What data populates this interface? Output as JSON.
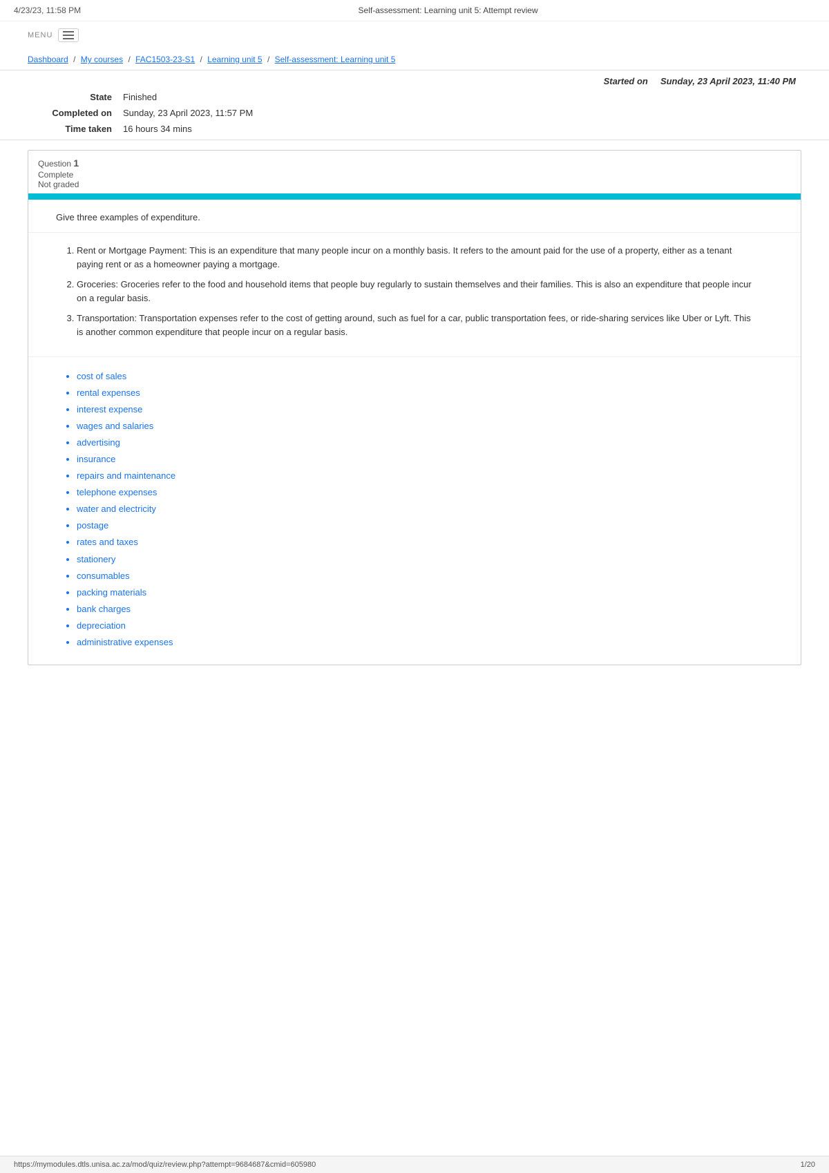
{
  "topbar": {
    "left": "4/23/23, 11:58 PM",
    "center": "Self-assessment: Learning unit 5: Attempt review"
  },
  "menu": {
    "label": "MENU"
  },
  "breadcrumb": {
    "items": [
      {
        "label": "Dashboard",
        "href": "#"
      },
      {
        "label": "My courses",
        "href": "#"
      },
      {
        "label": "FAC1503-23-S1",
        "href": "#"
      },
      {
        "label": "Learning unit 5",
        "href": "#"
      },
      {
        "label": "Self-assessment: Learning unit 5",
        "href": "#"
      }
    ],
    "separator": "/"
  },
  "attempt_info": {
    "started_on_label": "Started on",
    "started_on_value": "Sunday, 23 April 2023, 11:40 PM",
    "state_label": "State",
    "state_value": "Finished",
    "completed_on_label": "Completed on",
    "completed_on_value": "Sunday, 23 April 2023, 11:57 PM",
    "time_taken_label": "Time taken",
    "time_taken_value": "16 hours 34 mins"
  },
  "question": {
    "label": "Question",
    "number": "1",
    "status": "Complete",
    "grade": "Not graded",
    "prompt": "Give three examples of expenditure.",
    "answer_items": [
      {
        "text": "Rent or Mortgage Payment: This is an expenditure that many people incur on a monthly basis. It refers to the amount paid for the use of a property, either as a tenant paying rent or as a homeowner paying a mortgage."
      },
      {
        "text": "Groceries: Groceries refer to the food and household items that people buy regularly to sustain themselves and their families. This is also an expenditure that people incur on a regular basis."
      },
      {
        "text": "Transportation: Transportation expenses refer to the cost of getting around, such as fuel for a car, public transportation fees, or ride-sharing services like Uber or Lyft. This is another common expenditure that people incur on a regular basis."
      }
    ],
    "correct_answers": [
      "cost of sales",
      "rental expenses",
      "interest expense",
      "wages and salaries",
      "advertising",
      "insurance",
      "repairs and maintenance",
      "telephone expenses",
      "water and electricity",
      "postage",
      "rates and taxes",
      "stationery",
      "consumables",
      "packing materials",
      "bank charges",
      "depreciation",
      "administrative expenses"
    ]
  },
  "bottom_bar": {
    "url": "https://mymodules.dtls.unisa.ac.za/mod/quiz/review.php?attempt=9684687&cmid=605980",
    "page": "1/20"
  }
}
